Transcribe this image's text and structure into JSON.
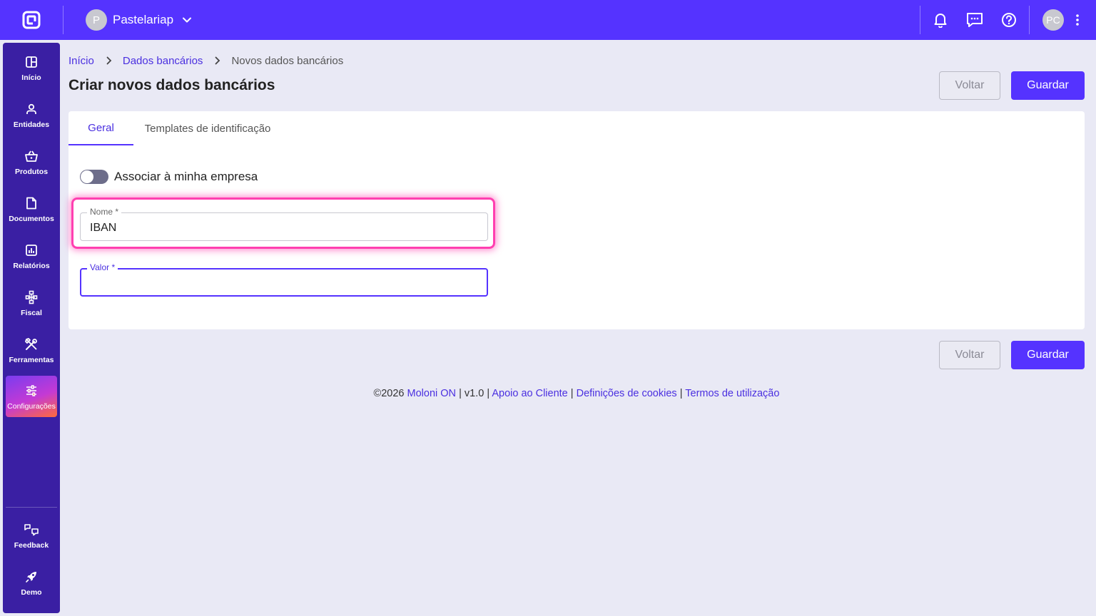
{
  "topbar": {
    "logo_icon": "moloni-logo-icon",
    "company": {
      "initial": "P",
      "name": "Pastelariap"
    },
    "icons": [
      "bell-icon",
      "chat-icon",
      "help-icon"
    ],
    "user_initials": "PC",
    "accent_color": "#5533ff"
  },
  "sidebar": {
    "items": [
      {
        "label": "Início",
        "icon": "dashboard-icon"
      },
      {
        "label": "Entidades",
        "icon": "user-icon"
      },
      {
        "label": "Produtos",
        "icon": "basket-icon"
      },
      {
        "label": "Documentos",
        "icon": "document-icon"
      },
      {
        "label": "Relatórios",
        "icon": "chart-icon"
      },
      {
        "label": "Fiscal",
        "icon": "fiscal-icon"
      },
      {
        "label": "Ferramentas",
        "icon": "tools-icon"
      },
      {
        "label": "Configurações",
        "icon": "sliders-icon",
        "active": true
      }
    ],
    "bottom_items": [
      {
        "label": "Feedback",
        "icon": "feedback-icon"
      },
      {
        "label": "Demo",
        "icon": "rocket-icon"
      }
    ]
  },
  "breadcrumb": {
    "items": [
      "Início",
      "Dados bancários"
    ],
    "current": "Novos dados bancários"
  },
  "page": {
    "title": "Criar novos dados bancários",
    "back_label": "Voltar",
    "save_label": "Guardar"
  },
  "tabs": [
    {
      "label": "Geral",
      "active": true
    },
    {
      "label": "Templates de identificação",
      "active": false
    }
  ],
  "form": {
    "toggle_label": "Associar à minha empresa",
    "toggle_on": false,
    "name_label": "Nome *",
    "name_value": "IBAN",
    "value_label": "Valor *",
    "value_value": ""
  },
  "footer": {
    "copyright": "©2026",
    "brand": "Moloni ON",
    "sep1": "|",
    "version": "v1.0",
    "sep2": "|",
    "support": "Apoio ao Cliente",
    "sep3": "|",
    "cookies": "Definições de cookies",
    "sep4": "|",
    "terms": "Termos de utilização"
  }
}
